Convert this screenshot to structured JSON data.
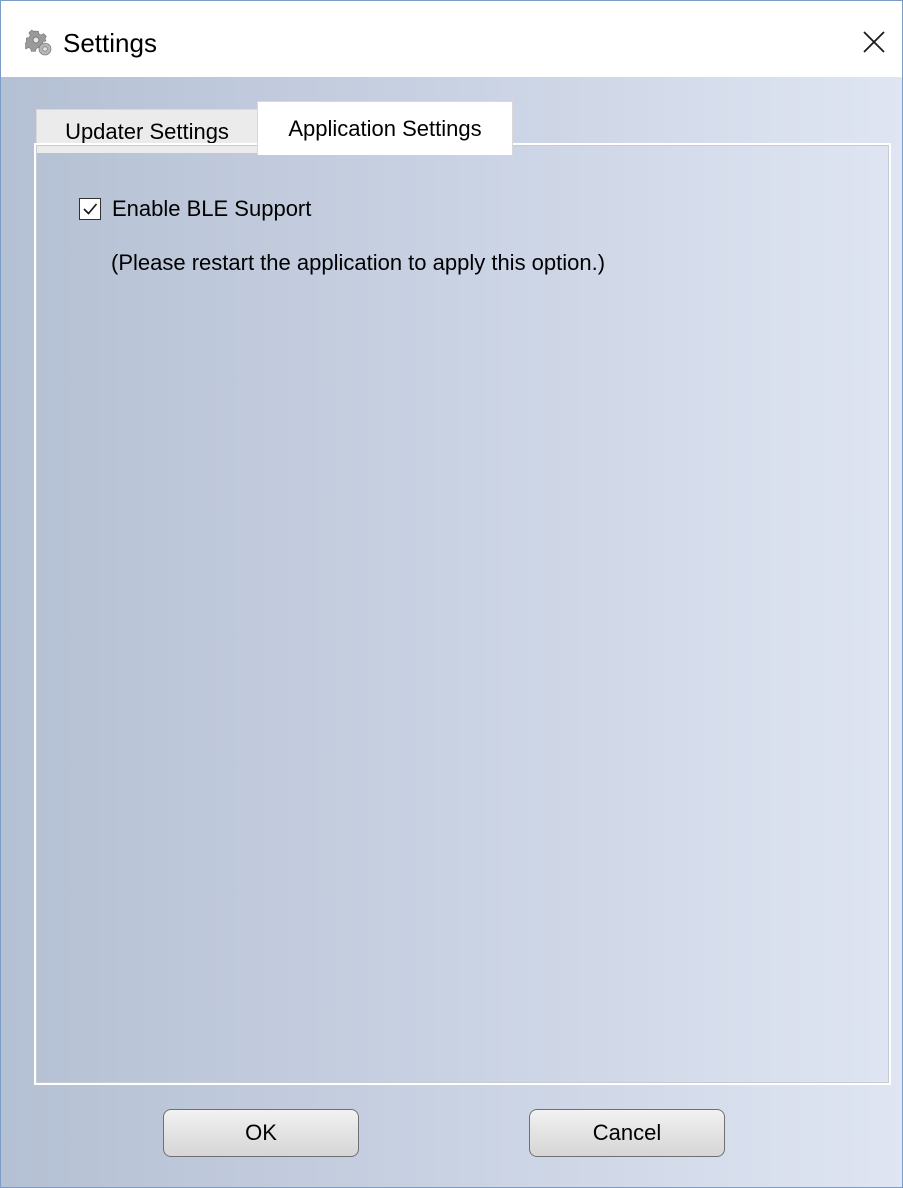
{
  "window": {
    "title": "Settings",
    "title_icon": "gear-icon",
    "close_icon": "close-icon"
  },
  "tabs": [
    {
      "label": "Updater Settings",
      "active": false
    },
    {
      "label": "Application Settings",
      "active": true
    }
  ],
  "application_settings": {
    "ble_checkbox": {
      "label": "Enable BLE Support",
      "checked": true
    },
    "hint": "(Please restart the application to apply this option.)"
  },
  "buttons": {
    "ok_label": "OK",
    "cancel_label": "Cancel"
  },
  "colors": {
    "window_border": "#7a9cc6",
    "client_gradient_start": "#b4c0d3",
    "client_gradient_end": "#dfe5f2"
  }
}
